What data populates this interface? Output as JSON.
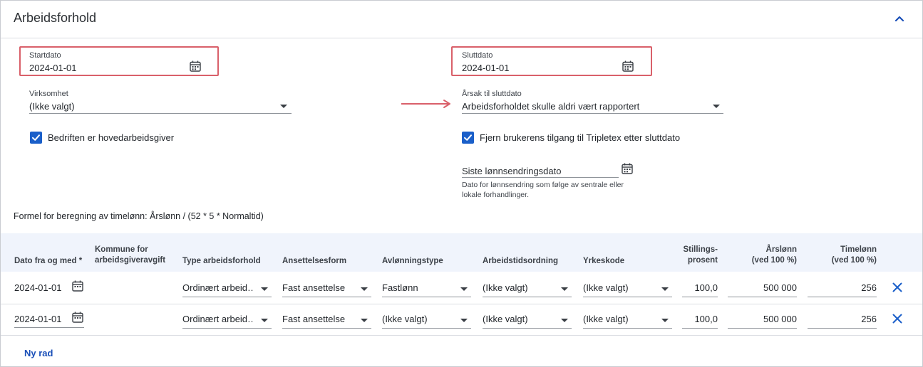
{
  "section": {
    "title": "Arbeidsforhold",
    "collapse_icon": "chevron-up-icon"
  },
  "colors": {
    "accent": "#1a5fc9",
    "highlight": "#d9606a",
    "header_bg": "#f0f4fc"
  },
  "fields": {
    "startdato": {
      "label": "Startdato",
      "value": "2024-01-01"
    },
    "sluttdato": {
      "label": "Sluttdato",
      "value": "2024-01-01"
    },
    "virksomhet": {
      "label": "Virksomhet",
      "value": "(Ikke valgt)"
    },
    "arsak": {
      "label": "Årsak til sluttdato",
      "value": "Arbeidsforholdet skulle aldri vært rapportert"
    },
    "hovedarbeidsgiver": {
      "label": "Bedriften er hovedarbeidsgiver",
      "checked": true
    },
    "fjern_tilgang": {
      "label": "Fjern brukerens tilgang til Tripletex etter sluttdato",
      "checked": true
    },
    "lonnsendring": {
      "placeholder": "Siste lønnsendringsdato",
      "help": "Dato for lønnsendring som følge av sentrale eller lokale forhandlinger."
    }
  },
  "formula": "Formel for beregning av timelønn: Årslønn / (52 * 5 * Normaltid)",
  "table": {
    "headers": {
      "dato": "Dato fra og med *",
      "kommune_1": "Kommune for",
      "kommune_2": "arbeidsgiveravgift",
      "type": "Type arbeidsforhold",
      "ansettelsesform": "Ansettelsesform",
      "avlonning": "Avlønningstype",
      "arbeidstid": "Arbeidstidsordning",
      "yrkeskode": "Yrkeskode",
      "stilling_1": "Stillings-",
      "stilling_2": "prosent",
      "arslonn_1": "Årslønn",
      "arslonn_2": "(ved 100 %)",
      "timelonn_1": "Timelønn",
      "timelonn_2": "(ved 100 %)"
    },
    "rows": [
      {
        "dato": "2024-01-01",
        "type": "Ordinært arbeid…",
        "ansettelsesform": "Fast ansettelse",
        "avlonning": "Fastlønn",
        "arbeidstid": "(Ikke valgt)",
        "yrkeskode": "(Ikke valgt)",
        "stilling": "100,0",
        "arslonn": "500 000",
        "timelonn": "256"
      },
      {
        "dato": "2024-01-01",
        "type": "Ordinært arbeid…",
        "ansettelsesform": "Fast ansettelse",
        "avlonning": "(Ikke valgt)",
        "arbeidstid": "(Ikke valgt)",
        "yrkeskode": "(Ikke valgt)",
        "stilling": "100,0",
        "arslonn": "500 000",
        "timelonn": "256"
      }
    ],
    "new_row_label": "Ny rad"
  }
}
